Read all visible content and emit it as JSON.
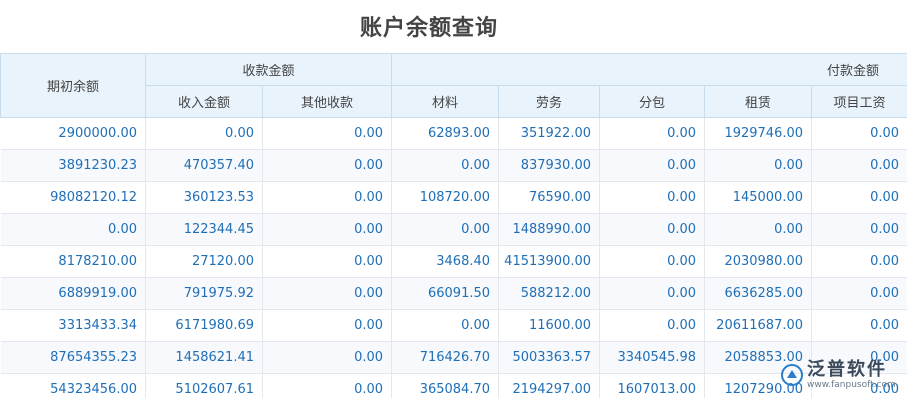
{
  "page": {
    "title": "账户余额查询"
  },
  "table": {
    "col_opening": "期初余额",
    "group_receipt": "收款金额",
    "group_payment": "付款金额",
    "sub_headers": [
      "收入金额",
      "其他收款",
      "材料",
      "劳务",
      "分包",
      "租赁",
      "项目工资"
    ],
    "rows": [
      [
        "2900000.00",
        "0.00",
        "0.00",
        "62893.00",
        "351922.00",
        "0.00",
        "1929746.00",
        "0.00"
      ],
      [
        "3891230.23",
        "470357.40",
        "0.00",
        "0.00",
        "837930.00",
        "0.00",
        "0.00",
        "0.00"
      ],
      [
        "98082120.12",
        "360123.53",
        "0.00",
        "108720.00",
        "76590.00",
        "0.00",
        "145000.00",
        "0.00"
      ],
      [
        "0.00",
        "122344.45",
        "0.00",
        "0.00",
        "1488990.00",
        "0.00",
        "0.00",
        "0.00"
      ],
      [
        "8178210.00",
        "27120.00",
        "0.00",
        "3468.40",
        "41513900.00",
        "0.00",
        "2030980.00",
        "0.00"
      ],
      [
        "6889919.00",
        "791975.92",
        "0.00",
        "66091.50",
        "588212.00",
        "0.00",
        "6636285.00",
        "0.00"
      ],
      [
        "3313433.34",
        "6171980.69",
        "0.00",
        "0.00",
        "11600.00",
        "0.00",
        "20611687.00",
        "0.00"
      ],
      [
        "87654355.23",
        "1458621.41",
        "0.00",
        "716426.70",
        "5003363.57",
        "3340545.98",
        "2058853.00",
        "0.00"
      ],
      [
        "54323456.00",
        "5102607.61",
        "0.00",
        "365084.70",
        "2194297.00",
        "1607013.00",
        "1207290.00",
        "0.00"
      ]
    ]
  },
  "watermark": {
    "brand": "泛普软件",
    "url": "www.fanpusoft.com",
    "color": "#2a7fc8"
  }
}
